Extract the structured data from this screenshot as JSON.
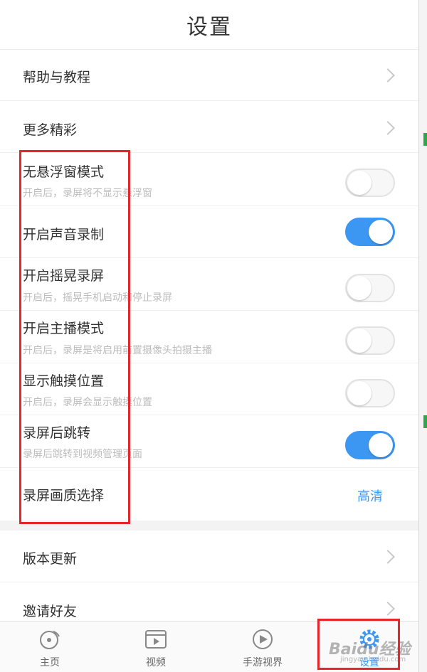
{
  "header": {
    "title": "设置"
  },
  "menu": [
    {
      "label": "帮助与教程"
    },
    {
      "label": "更多精彩"
    }
  ],
  "toggles": [
    {
      "label": "无悬浮窗模式",
      "sub": "开启后，录屏将不显示悬浮窗",
      "on": false
    },
    {
      "label": "开启声音录制",
      "sub": "",
      "on": true
    },
    {
      "label": "开启摇晃录屏",
      "sub": "开启后，摇晃手机启动和停止录屏",
      "on": false
    },
    {
      "label": "开启主播模式",
      "sub": "开启后，录屏是将启用前置摄像头拍摄主播",
      "on": false
    },
    {
      "label": "显示触摸位置",
      "sub": "开启后，录屏会显示触摸位置",
      "on": false
    },
    {
      "label": "录屏后跳转",
      "sub": "录屏后跳转到视频管理页面",
      "on": true
    }
  ],
  "quality": {
    "label": "录屏画质选择",
    "value": "高清"
  },
  "menu2": [
    {
      "label": "版本更新"
    },
    {
      "label": "邀请好友"
    }
  ],
  "tabs": [
    {
      "label": "主页",
      "icon": "home-record-icon"
    },
    {
      "label": "视频",
      "icon": "video-icon"
    },
    {
      "label": "手游视界",
      "icon": "play-icon"
    },
    {
      "label": "设置",
      "icon": "gear-icon"
    }
  ],
  "watermark": {
    "text": "Baidu经验",
    "sub": "jingyan.baidu.com"
  },
  "colors": {
    "accent": "#3b97f2",
    "highlight": "#e5262b",
    "toggle_off": "#f7f7f7"
  }
}
